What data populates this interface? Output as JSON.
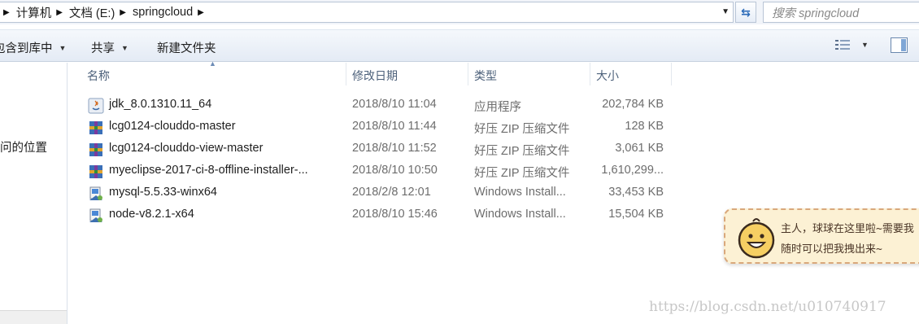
{
  "address": {
    "crumbs": [
      "计算机",
      "文档 (E:)",
      "springcloud"
    ]
  },
  "search": {
    "placeholder": "搜索 springcloud"
  },
  "toolbar": {
    "include_label": "包含到库中",
    "share_label": "共享",
    "new_folder_label": "新建文件夹"
  },
  "nav": {
    "item": "问的位置"
  },
  "columns": {
    "name": "名称",
    "date": "修改日期",
    "type": "类型",
    "size": "大小"
  },
  "files": [
    {
      "name": "jdk_8.0.1310.11_64",
      "date": "2018/8/10 11:04",
      "type": "应用程序",
      "size": "202,784 KB",
      "icon": "java-installer-icon"
    },
    {
      "name": "lcg0124-clouddo-master",
      "date": "2018/8/10 11:44",
      "type": "好压 ZIP 压缩文件",
      "size": "128 KB",
      "icon": "zip-archive-icon"
    },
    {
      "name": "lcg0124-clouddo-view-master",
      "date": "2018/8/10 11:52",
      "type": "好压 ZIP 压缩文件",
      "size": "3,061 KB",
      "icon": "zip-archive-icon"
    },
    {
      "name": "myeclipse-2017-ci-8-offline-installer-...",
      "date": "2018/8/10 10:50",
      "type": "好压 ZIP 压缩文件",
      "size": "1,610,299...",
      "icon": "zip-archive-icon"
    },
    {
      "name": "mysql-5.5.33-winx64",
      "date": "2018/2/8 12:01",
      "type": "Windows Install...",
      "size": "33,453 KB",
      "icon": "msi-installer-icon"
    },
    {
      "name": "node-v8.2.1-x64",
      "date": "2018/8/10 15:46",
      "type": "Windows Install...",
      "size": "15,504 KB",
      "icon": "msi-installer-icon"
    }
  ],
  "widget": {
    "line1": "主人，球球在这里啦~需要我",
    "line2": "随时可以把我拽出来~"
  },
  "watermark": "https://blog.csdn.net/u010740917"
}
